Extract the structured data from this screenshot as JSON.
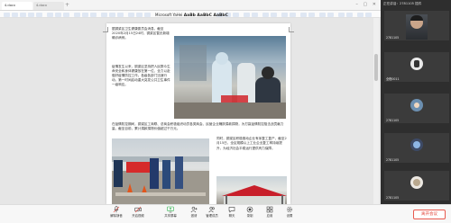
{
  "tabs": [
    {
      "label": "4.docx"
    },
    {
      "label": "4.docx"
    }
  ],
  "ribbon": {
    "font_name": "Microsoft YaHei",
    "font_samples": "AaBb AaBbC AaBbC"
  },
  "document": {
    "para1": "据铜梁区卫生健康委员会消息，截至2020年2月15日24时，铜梁区暂无新增确诊病例。",
    "para2": "疫情发生以来，铜梁区坚持把人民群众生命安全和身体健康放在第一位，全力以赴做好疫情防控工作。各级各部门迅速行动，第一时间启动重大突发公共卫生事件一级响应。",
    "para3": "在疫情防控期间，铜梁区工商联、总商会积极组织动员各类商会、民营企业踊跃捐款捐物，为打赢疫情防控阻击战贡献力量。截至目前，累计捐款捐物价值超过千万元。",
    "para4": "同时，铜梁区积极推动企业有序复工复产，截至2月15日，全区规模以上工业企业复工率持续提升，为经济社会平稳运行提供有力保障。"
  },
  "participants": {
    "header": "正在讲话：2781105 插件",
    "tiles": [
      {
        "name": "2781105"
      },
      {
        "name": "全程0011"
      },
      {
        "name": "2781105"
      },
      {
        "name": "2781105"
      },
      {
        "name": "2781105"
      }
    ]
  },
  "toolbar": {
    "items": [
      {
        "label": "解除静音"
      },
      {
        "label": "开启视频"
      },
      {
        "label": "共享屏幕"
      },
      {
        "label": "邀请"
      },
      {
        "label": "管理成员"
      },
      {
        "label": "聊天"
      },
      {
        "label": "录制"
      },
      {
        "label": "应用"
      },
      {
        "label": "设置"
      }
    ],
    "end_label": "离开会议"
  },
  "colors": {
    "end_button": "#e2463a",
    "accent": "#1a73e8"
  }
}
